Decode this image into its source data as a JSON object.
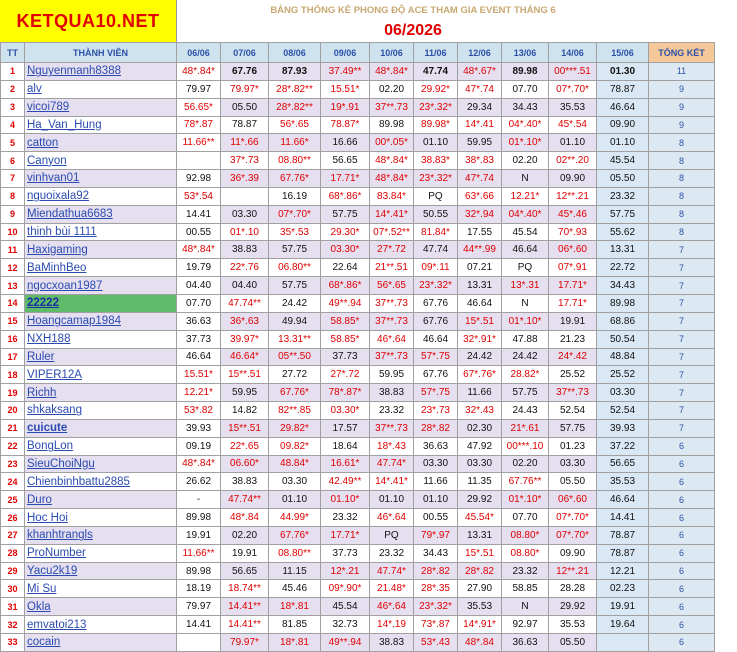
{
  "logo": "KETQUA10.NET",
  "title": "BẢNG THỐNG KÊ PHONG ĐỘ ACE THAM GIA EVENT THÁNG 6",
  "month": "06/2026",
  "headers": {
    "tt": "TT",
    "member": "THÀNH VIÊN",
    "dates": [
      "06/06",
      "07/06",
      "08/06",
      "09/06",
      "10/06",
      "11/06",
      "12/06",
      "13/06",
      "14/06",
      "15/06"
    ],
    "total": "TỔNG KẾT"
  },
  "rows": [
    {
      "tt": "1",
      "name": "Nguyenmanh8388",
      "vals": [
        "48*.84*",
        "67.76",
        "87.93",
        "37.49**",
        "48*.84*",
        "47.74",
        "48*.67*",
        "89.98",
        "00***.51",
        "01.30"
      ],
      "total": "11"
    },
    {
      "tt": "2",
      "name": "alv",
      "vals": [
        "79.97",
        "79.97*",
        "28*.82**",
        "15.51*",
        "02.20",
        "29.92*",
        "47*.74",
        "07.70",
        "07*.70*",
        "78.87"
      ],
      "total": "9"
    },
    {
      "tt": "3",
      "name": "vicoi789",
      "vals": [
        "56.65*",
        "05.50",
        "28*.82**",
        "19*.91",
        "37**.73",
        "23*.32*",
        "29.34",
        "34.43",
        "35.53",
        "46.64"
      ],
      "total": "9"
    },
    {
      "tt": "4",
      "name": "Ha_Van_Hung",
      "vals": [
        "78*.87",
        "78.87",
        "56*.65",
        "78.87*",
        "89.98",
        "89.98*",
        "14*.41",
        "04*.40*",
        "45*.54",
        "09.90"
      ],
      "total": "9"
    },
    {
      "tt": "5",
      "name": "catton",
      "vals": [
        "11.66**",
        "11*.66",
        "11.66*",
        "16.66",
        "00*.05*",
        "01.10",
        "59.95",
        "01*.10*",
        "01.10",
        "01.10"
      ],
      "total": "8"
    },
    {
      "tt": "6",
      "name": "Canyon",
      "vals": [
        "",
        "37*.73",
        "08.80**",
        "56.65",
        "48*.84*",
        "38.83*",
        "38*.83",
        "02.20",
        "02**.20",
        "45.54"
      ],
      "total": "8"
    },
    {
      "tt": "7",
      "name": "vinhvan01",
      "vals": [
        "92.98",
        "36*.39",
        "67.76*",
        "17.71*",
        "48*.84*",
        "23*.32*",
        "47*.74",
        "N",
        "09.90",
        "05.50"
      ],
      "total": "8"
    },
    {
      "tt": "8",
      "name": "nguoixala92",
      "vals": [
        "53*.54",
        "",
        "16.19",
        "68*.86*",
        "83.84*",
        "PQ",
        "63*.66",
        "12.21*",
        "12**.21",
        "23.32"
      ],
      "total": "8"
    },
    {
      "tt": "9",
      "name": "Miendathua6683",
      "vals": [
        "14.41",
        "03.30",
        "07*.70*",
        "57.75",
        "14*.41*",
        "50.55",
        "32*.94",
        "04*.40*",
        "45*.46",
        "57.75"
      ],
      "total": "8"
    },
    {
      "tt": "10",
      "name": "thinh bùi 1111",
      "vals": [
        "00.55",
        "01*.10",
        "35*.53",
        "29.30*",
        "07*.52**",
        "81.84*",
        "17.55",
        "45.54",
        "70*.93",
        "55.62"
      ],
      "total": "8"
    },
    {
      "tt": "11",
      "name": "Haxigaming",
      "vals": [
        "48*.84*",
        "38.83",
        "57.75",
        "03.30*",
        "27*.72",
        "47.74",
        "44**.99",
        "46.64",
        "06*.60",
        "13.31"
      ],
      "total": "7"
    },
    {
      "tt": "12",
      "name": "BaMinhBeo",
      "vals": [
        "19.79",
        "22*.76",
        "06.80**",
        "22.64",
        "21**.51",
        "09*.11",
        "07.21",
        "PQ",
        "07*.91",
        "22.72"
      ],
      "total": "7"
    },
    {
      "tt": "13",
      "name": "ngocxoan1987",
      "vals": [
        "04.40",
        "04.40",
        "57.75",
        "68*.86*",
        "56*.65",
        "23*.32*",
        "13.31",
        "13*.31",
        "17.71*",
        "34.43"
      ],
      "total": "7"
    },
    {
      "tt": "14",
      "name": "22222",
      "vals": [
        "07.70",
        "47.74**",
        "24.42",
        "49**.94",
        "37**.73",
        "67.76",
        "46.64",
        "N",
        "17.71*",
        "89.98"
      ],
      "total": "7"
    },
    {
      "tt": "15",
      "name": "Hoangcamap1984",
      "vals": [
        "36.63",
        "36*.63",
        "49.94",
        "58.85*",
        "37**.73",
        "67.76",
        "15*.51",
        "01*.10*",
        "19.91",
        "68.86"
      ],
      "total": "7"
    },
    {
      "tt": "16",
      "name": "NXH188",
      "vals": [
        "37.73",
        "39.97*",
        "13.31**",
        "58.85*",
        "46*.64",
        "46.64",
        "32*.91*",
        "47.88",
        "21.23",
        "50.54"
      ],
      "total": "7"
    },
    {
      "tt": "17",
      "name": "Ruler",
      "vals": [
        "46.64",
        "46.64*",
        "05**.50",
        "37.73",
        "37**.73",
        "57*.75",
        "24.42",
        "24.42",
        "24*.42",
        "48.84"
      ],
      "total": "7"
    },
    {
      "tt": "18",
      "name": "VIPER12A",
      "vals": [
        "15.51*",
        "15**.51",
        "27.72",
        "27*.72",
        "59.95",
        "67.76",
        "67*.76*",
        "28.82*",
        "25.52",
        "25.52"
      ],
      "total": "7"
    },
    {
      "tt": "19",
      "name": "Richh",
      "vals": [
        "12.21*",
        "59.95",
        "67.76*",
        "78*.87*",
        "38.83",
        "57*.75",
        "11.66",
        "57.75",
        "37**.73",
        "03.30"
      ],
      "total": "7"
    },
    {
      "tt": "20",
      "name": "shkaksang",
      "vals": [
        "53*.82",
        "14.82",
        "82**.85",
        "03.30*",
        "23.32",
        "23*.73",
        "32*.43",
        "24.43",
        "52.54",
        "52.54"
      ],
      "total": "7"
    },
    {
      "tt": "21",
      "name": "cuicute",
      "vals": [
        "39.93",
        "15**.51",
        "29.82*",
        "17.57",
        "37**.73",
        "28*.82",
        "02.30",
        "21*.61",
        "57.75",
        "39.93"
      ],
      "total": "7"
    },
    {
      "tt": "22",
      "name": "BongLon",
      "vals": [
        "09.19",
        "22*.65",
        "09.82*",
        "18.64",
        "18*.43",
        "36.63",
        "47.92",
        "00***.10",
        "01.23",
        "37.22"
      ],
      "total": "6"
    },
    {
      "tt": "23",
      "name": "SieuChoiNgu",
      "vals": [
        "48*.84*",
        "06.60*",
        "48.84*",
        "16.61*",
        "47.74*",
        "03.30",
        "03.30",
        "02.20",
        "03.30",
        "56.65"
      ],
      "total": "6"
    },
    {
      "tt": "24",
      "name": "Chienbinhbattu2885",
      "vals": [
        "26.62",
        "38.83",
        "03.30",
        "42.49**",
        "14*.41*",
        "11.66",
        "11.35",
        "67.76**",
        "05.50",
        "35.53"
      ],
      "total": "6"
    },
    {
      "tt": "25",
      "name": "Duro",
      "vals": [
        "-",
        "47.74**",
        "01.10",
        "01.10*",
        "01.10",
        "01.10",
        "29.92",
        "01*.10*",
        "06*.60",
        "46.64"
      ],
      "total": "6"
    },
    {
      "tt": "26",
      "name": "Hoc Hoi",
      "vals": [
        "89.98",
        "48*.84",
        "44.99*",
        "23.32",
        "46*.64",
        "00.55",
        "45.54*",
        "07.70",
        "07*.70*",
        "14.41"
      ],
      "total": "6"
    },
    {
      "tt": "27",
      "name": "khanhtrangls",
      "vals": [
        "19.91",
        "02.20",
        "67.76*",
        "17.71*",
        "PQ",
        "79*.97",
        "13.31",
        "08.80*",
        "07*.70*",
        "78.87"
      ],
      "total": "6"
    },
    {
      "tt": "28",
      "name": "ProNumber",
      "vals": [
        "11.66**",
        "19.91",
        "08.80**",
        "37.73",
        "23.32",
        "34.43",
        "15*.51",
        "08.80*",
        "09.90",
        "78.87"
      ],
      "total": "6"
    },
    {
      "tt": "29",
      "name": "Yacu2k19",
      "vals": [
        "89.98",
        "56.65",
        "11.15",
        "12*.21",
        "47.74*",
        "28*.82",
        "28*.82",
        "23.32",
        "12**.21",
        "12.21"
      ],
      "total": "6"
    },
    {
      "tt": "30",
      "name": "Mi Su",
      "vals": [
        "18.19",
        "18.74**",
        "45.46",
        "09*.90*",
        "21.48*",
        "28*.35",
        "27.90",
        "58.85",
        "28.28",
        "02.23"
      ],
      "total": "6"
    },
    {
      "tt": "31",
      "name": "Okla",
      "vals": [
        "79.97",
        "14.41**",
        "18*.81",
        "45.54",
        "46*.64",
        "23*.32*",
        "35.53",
        "N",
        "29.92",
        "19.91"
      ],
      "total": "6"
    },
    {
      "tt": "32",
      "name": "emvatoi213",
      "vals": [
        "14.41",
        "14.41**",
        "81.85",
        "32.73",
        "14*.19",
        "73*.87",
        "14*.91*",
        "92.97",
        "35.53",
        "19.64"
      ],
      "total": "6"
    },
    {
      "tt": "33",
      "name": "cocain",
      "vals": [
        "",
        "79.97*",
        "18*.81",
        "49**.94",
        "38.83",
        "53*.43",
        "48*.84",
        "36.63",
        "05.50",
        ""
      ],
      "total": "6"
    }
  ],
  "blackBoldRows": [
    "1"
  ],
  "colors": {
    "logo_bg": "#ffff00",
    "logo_text": "#e00000",
    "header_bg": "#cfe3ef",
    "total_header_bg": "#f5c89a",
    "alt_row_bg": "#e6dff0",
    "highlight_name_bg": "#5fba6a",
    "star_text": "#e00000",
    "name_text": "#2a4bb0"
  }
}
